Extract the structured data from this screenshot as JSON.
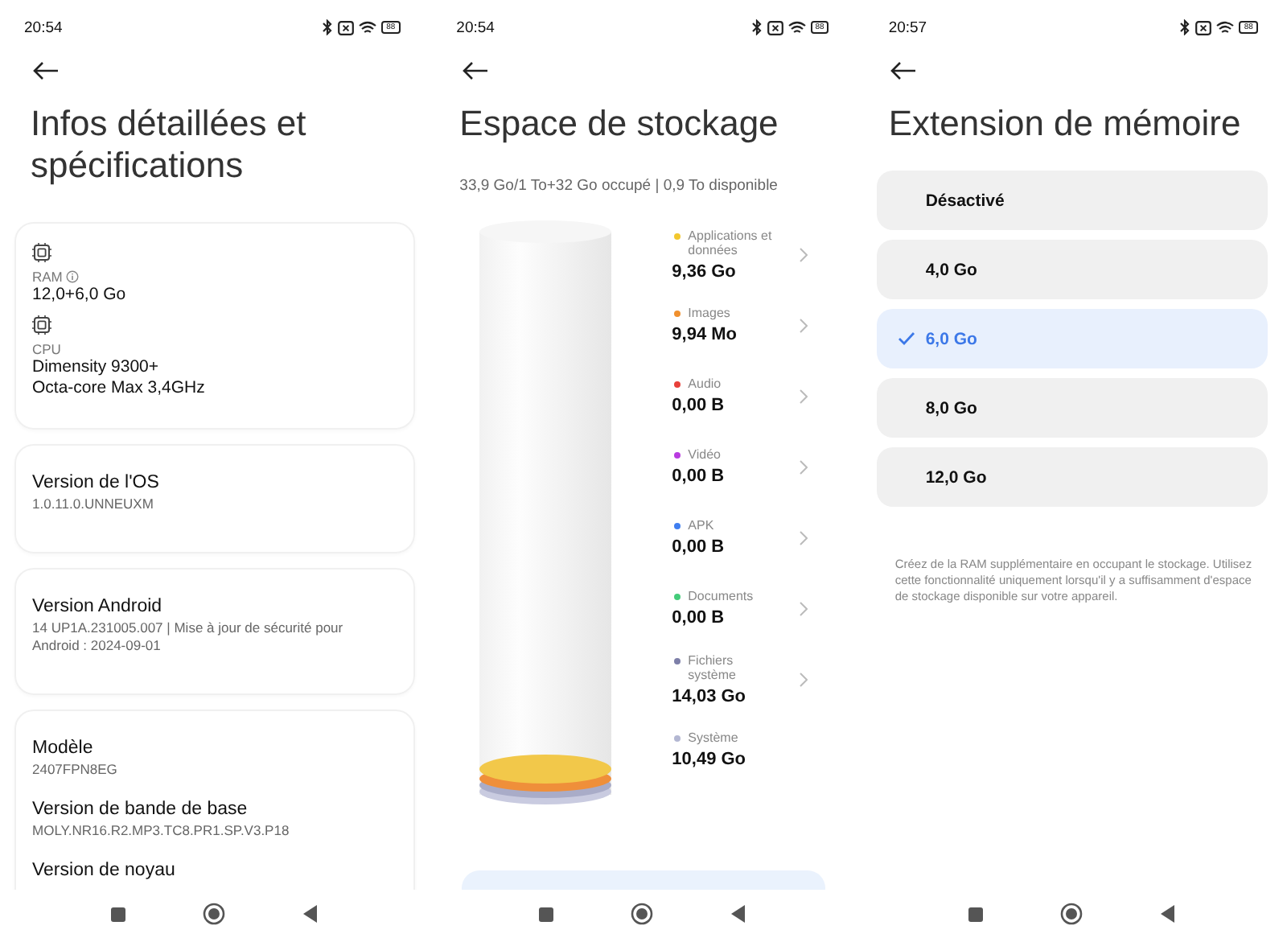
{
  "screens": [
    {
      "kind": "specs",
      "status_bar": {
        "time": "20:54",
        "battery": "88"
      },
      "title": "Infos détaillées et spécifications",
      "cards": [
        {
          "items": [
            {
              "kind": "spec",
              "label": "RAM",
              "info": true,
              "lines": [
                "12,0+6,0 Go"
              ]
            },
            {
              "kind": "spec",
              "label": "CPU",
              "info": false,
              "lines": [
                "Dimensity 9300+",
                "Octa-core Max 3,4GHz"
              ]
            }
          ]
        },
        {
          "items": [
            {
              "kind": "row",
              "label": "Version de l'OS",
              "lines": [
                "1.0.11.0.UNNEUXM"
              ]
            }
          ]
        },
        {
          "items": [
            {
              "kind": "row",
              "label": "Version Android",
              "lines": [
                "14 UP1A.231005.007 | Mise à jour de sécurité pour Android : 2024-09-01"
              ]
            }
          ]
        },
        {
          "items": [
            {
              "kind": "row",
              "label": "Modèle",
              "lines": [
                "2407FPN8EG"
              ]
            },
            {
              "kind": "row",
              "label": "Version de bande de base",
              "lines": [
                "MOLY.NR16.R2.MP3.TC8.PR1.SP.V3.P18"
              ]
            },
            {
              "kind": "row",
              "label": "Version de noyau"
            }
          ]
        }
      ]
    },
    {
      "kind": "storage",
      "status_bar": {
        "time": "20:54",
        "battery": "88"
      },
      "title": "Espace de stockage",
      "summary": "33,9 Go/1 To+32 Go occupé | 0,9 To disponible",
      "categories": [
        {
          "name": "Applications et données",
          "size": "9,36 Go",
          "color": "#f2c72e",
          "chevron": true
        },
        {
          "name": "Images",
          "size": "9,94 Mo",
          "color": "#f0902e",
          "chevron": true
        },
        {
          "name": "Audio",
          "size": "0,00 B",
          "color": "#e8403a",
          "chevron": true
        },
        {
          "name": "Vidéo",
          "size": "0,00 B",
          "color": "#b93be0",
          "chevron": true
        },
        {
          "name": "APK",
          "size": "0,00 B",
          "color": "#3f7ef0",
          "chevron": true
        },
        {
          "name": "Documents",
          "size": "0,00 B",
          "color": "#44cc7a",
          "chevron": true
        },
        {
          "name": "Fichiers système",
          "size": "14,03 Go",
          "color": "#7d7fa8",
          "chevron": true
        },
        {
          "name": "Système",
          "size": "10,49 Go",
          "color": "#b3b7d2",
          "chevron": false
        }
      ]
    },
    {
      "kind": "memory",
      "status_bar": {
        "time": "20:57",
        "battery": "88"
      },
      "title": "Extension de mémoire",
      "options": [
        {
          "label": "Désactivé",
          "selected": false
        },
        {
          "label": "4,0 Go",
          "selected": false
        },
        {
          "label": "6,0 Go",
          "selected": true
        },
        {
          "label": "8,0 Go",
          "selected": false
        },
        {
          "label": "12,0 Go",
          "selected": false
        }
      ],
      "description": "Créez de la RAM supplémentaire en occupant le stockage. Utilisez cette fonctionnalité uniquement lorsqu'il y a suffisamment d'espace de stockage disponible sur votre appareil."
    }
  ]
}
